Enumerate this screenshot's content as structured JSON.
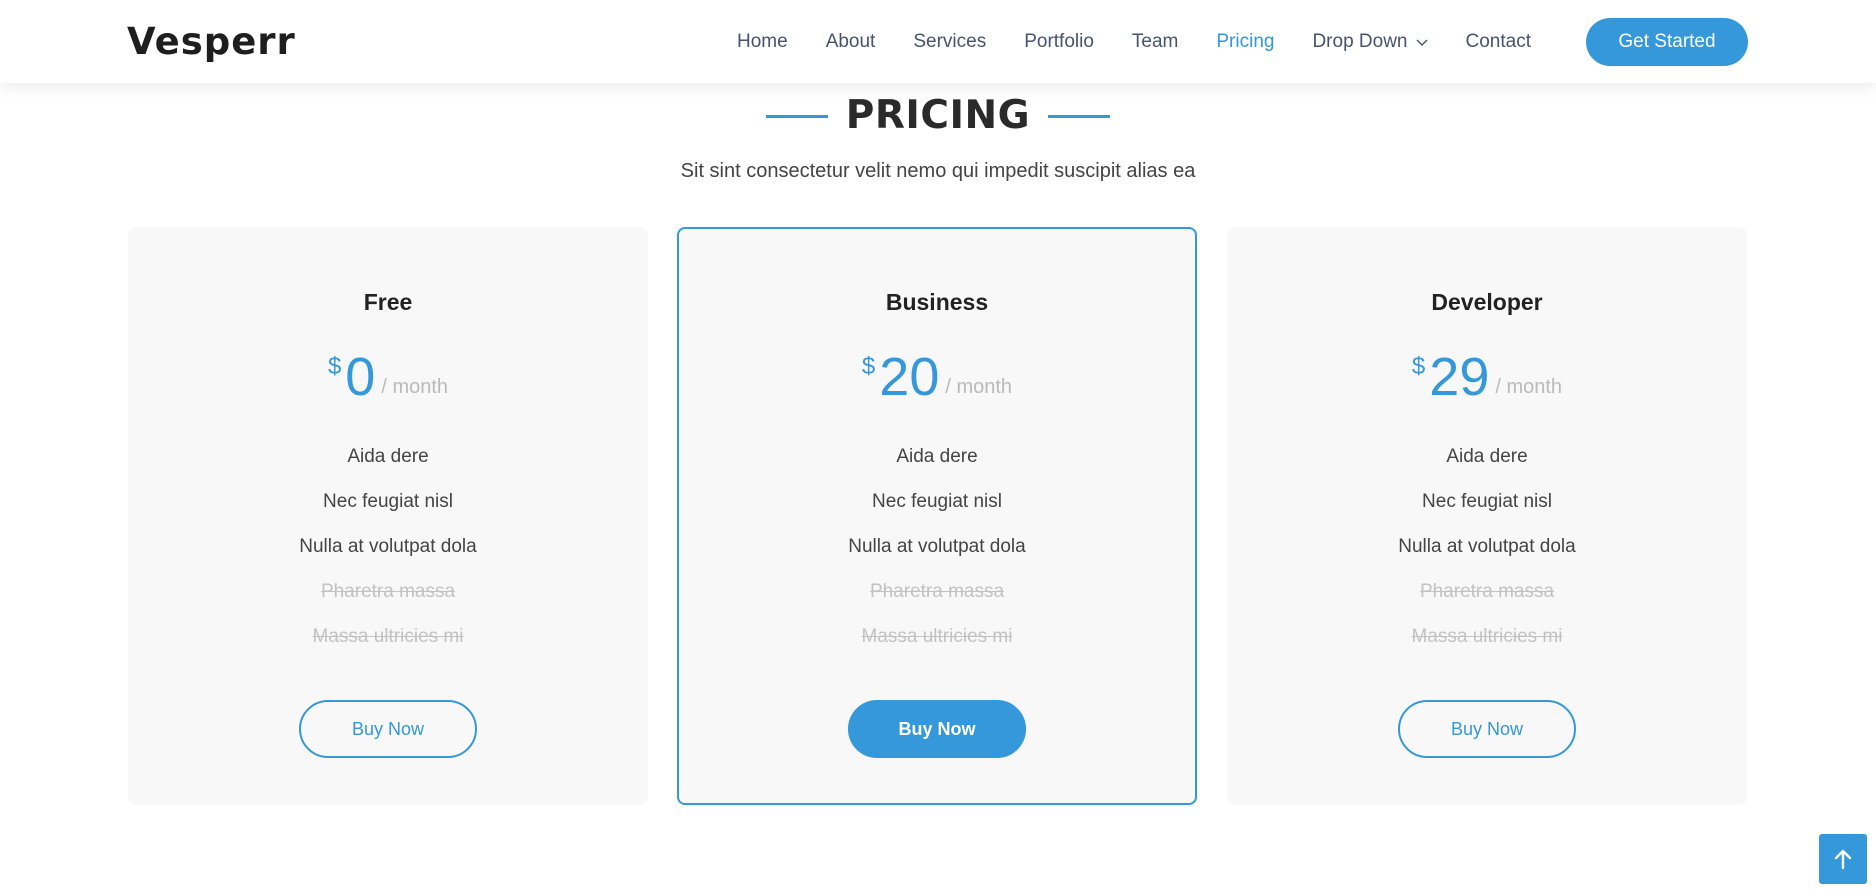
{
  "header": {
    "logo": "Vesperr",
    "nav": [
      {
        "label": "Home",
        "active": false
      },
      {
        "label": "About",
        "active": false
      },
      {
        "label": "Services",
        "active": false
      },
      {
        "label": "Portfolio",
        "active": false
      },
      {
        "label": "Team",
        "active": false
      },
      {
        "label": "Pricing",
        "active": true
      },
      {
        "label": "Drop Down",
        "active": false,
        "has_dropdown": true
      },
      {
        "label": "Contact",
        "active": false
      }
    ],
    "cta_label": "Get Started"
  },
  "section": {
    "title": "PRICING",
    "subtitle": "Sit sint consectetur velit nemo qui impedit suscipit alias ea"
  },
  "plans": [
    {
      "name": "Free",
      "currency": "$",
      "amount": "0",
      "period": "/ month",
      "features": [
        {
          "text": "Aida dere",
          "available": true
        },
        {
          "text": "Nec feugiat nisl",
          "available": true
        },
        {
          "text": "Nulla at volutpat dola",
          "available": true
        },
        {
          "text": "Pharetra massa",
          "available": false
        },
        {
          "text": "Massa ultricies mi",
          "available": false
        }
      ],
      "button_label": "Buy Now",
      "featured": false
    },
    {
      "name": "Business",
      "currency": "$",
      "amount": "20",
      "period": "/ month",
      "features": [
        {
          "text": "Aida dere",
          "available": true
        },
        {
          "text": "Nec feugiat nisl",
          "available": true
        },
        {
          "text": "Nulla at volutpat dola",
          "available": true
        },
        {
          "text": "Pharetra massa",
          "available": false
        },
        {
          "text": "Massa ultricies mi",
          "available": false
        }
      ],
      "button_label": "Buy Now",
      "featured": true
    },
    {
      "name": "Developer",
      "currency": "$",
      "amount": "29",
      "period": "/ month",
      "features": [
        {
          "text": "Aida dere",
          "available": true
        },
        {
          "text": "Nec feugiat nisl",
          "available": true
        },
        {
          "text": "Nulla at volutpat dola",
          "available": true
        },
        {
          "text": "Pharetra massa",
          "available": false
        },
        {
          "text": "Massa ultricies mi",
          "available": false
        }
      ],
      "button_label": "Buy Now",
      "featured": false
    }
  ],
  "icons": {
    "dropdown": "chevron-down-icon",
    "back_to_top": "arrow-up-icon"
  },
  "colors": {
    "accent": "#3498db",
    "heading": "#222222",
    "text": "#444444",
    "muted": "#c2c2c2",
    "card_bg": "#f8f8f8"
  }
}
